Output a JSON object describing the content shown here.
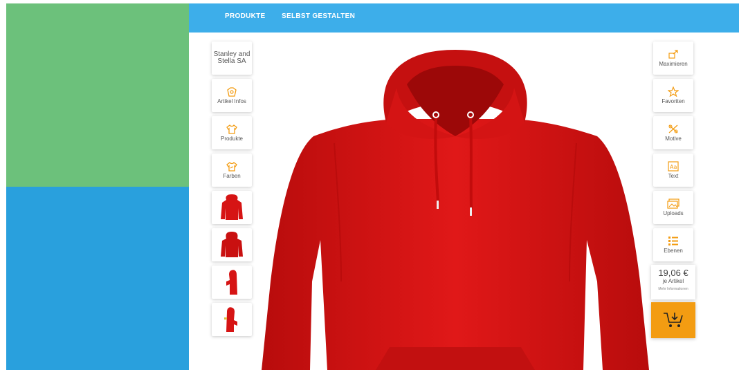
{
  "nav": {
    "products": "PRODUKTE",
    "design": "SELBST GESTALTEN"
  },
  "left_tools": {
    "brand": "Stanley and Stella SA",
    "info": "Artikel Infos",
    "products": "Produkte",
    "colors": "Farben"
  },
  "right_tools": {
    "maximize": "Maximieren",
    "favorites": "Favoriten",
    "motifs": "Motive",
    "text": "Text",
    "uploads": "Uploads",
    "layers": "Ebenen"
  },
  "price": {
    "amount": "19,06 €",
    "per": "je Artikel",
    "more": "Mehr Informationen"
  },
  "icons": {
    "info": "info-icon",
    "products": "shirt-icon",
    "colors": "palette-shirt-icon",
    "maximize": "maximize-icon",
    "favorites": "star-icon",
    "motifs": "motif-icon",
    "text": "text-icon",
    "uploads": "image-upload-icon",
    "layers": "layers-icon",
    "cart": "cart-icon"
  },
  "colors": {
    "accent": "#f39c12",
    "topbar": "#3daeea",
    "product": "#d61414",
    "left_green": "#6cc17b",
    "left_blue": "#29a0dd"
  }
}
